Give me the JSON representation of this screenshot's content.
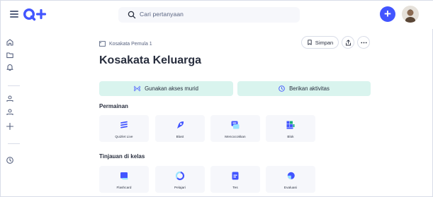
{
  "search": {
    "placeholder": "Cari pertanyaan"
  },
  "breadcrumb": {
    "set_name": "Kosakata Pemula 1"
  },
  "actions": {
    "save_label": "Simpan"
  },
  "page": {
    "title": "Kosakata Keluarga"
  },
  "cta": {
    "student_access": "Gunakan akses murid",
    "give_activity": "Berikan aktivitas"
  },
  "games": {
    "heading": "Permainan",
    "items": [
      {
        "label": "Quizlet Live",
        "icon": "quizlet-live-icon"
      },
      {
        "label": "Blast",
        "icon": "blast-icon"
      },
      {
        "label": "Mencocokkan",
        "icon": "match-icon"
      },
      {
        "label": "Blok",
        "icon": "blocks-icon"
      }
    ]
  },
  "review": {
    "heading": "Tinjauan di kelas",
    "items": [
      {
        "label": "Flashcard",
        "icon": "flashcard-icon"
      },
      {
        "label": "Pelajari",
        "icon": "learn-icon"
      },
      {
        "label": "Tes",
        "icon": "test-icon"
      },
      {
        "label": "Evaluasi",
        "icon": "checkpoint-icon"
      }
    ]
  },
  "colors": {
    "brand": "#4255ff",
    "cta_bg": "#d9f4ee",
    "card_bg": "#f6f7fb",
    "text": "#282e3e",
    "muted": "#586380"
  }
}
